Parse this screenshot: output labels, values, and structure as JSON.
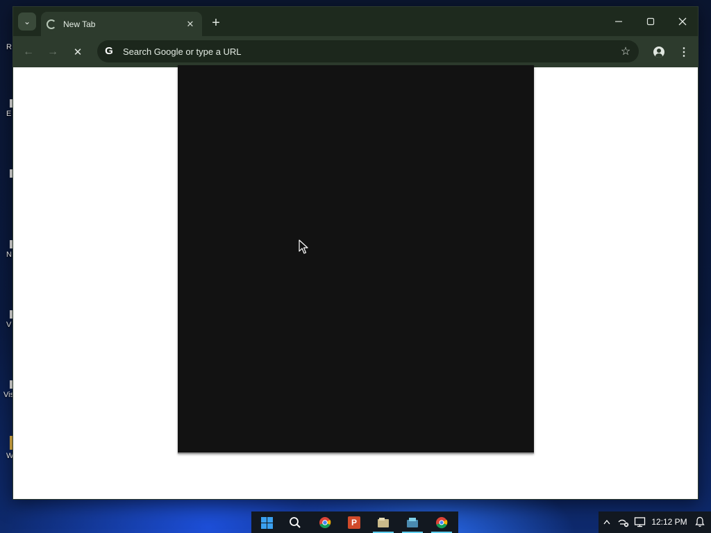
{
  "desktop": {
    "icons": [
      {
        "label": "R"
      },
      {
        "label": "E"
      },
      {
        "label": ""
      },
      {
        "label": "N"
      },
      {
        "label": "V"
      },
      {
        "label": "Vis"
      },
      {
        "label": "W"
      }
    ]
  },
  "browser": {
    "tab": {
      "title": "New Tab",
      "close_glyph": "✕",
      "icon": "loading-spinner-icon"
    },
    "tab_search_glyph": "⌄",
    "new_tab_glyph": "+",
    "window_controls": {
      "minimize": "—",
      "maximize": "☐",
      "close": "✕"
    },
    "toolbar": {
      "back_glyph": "←",
      "forward_glyph": "→",
      "stop_glyph": "✕",
      "omnibox_placeholder": "Search Google or type a URL",
      "search_engine_glyph": "G",
      "bookmark_glyph": "☆",
      "menu_glyph": "⋮"
    }
  },
  "taskbar": {
    "apps": [
      {
        "name": "start",
        "icon": "windows-start-icon"
      },
      {
        "name": "search",
        "icon": "search-icon"
      },
      {
        "name": "chrome",
        "icon": "chrome-icon"
      },
      {
        "name": "powerpoint",
        "icon": "powerpoint-icon",
        "glyph": "P"
      },
      {
        "name": "files",
        "icon": "file-manager-icon"
      },
      {
        "name": "app",
        "icon": "app-icon"
      },
      {
        "name": "chrome-alt",
        "icon": "chrome-alt-icon"
      }
    ],
    "tray": {
      "chevron_glyph": "^",
      "clock": "12:12 PM"
    }
  },
  "colors": {
    "titlebar": "#1e2a1e",
    "toolbar": "#2d3b2d",
    "panel": "#121212",
    "taskbar_accent": "#5fd0f0"
  }
}
